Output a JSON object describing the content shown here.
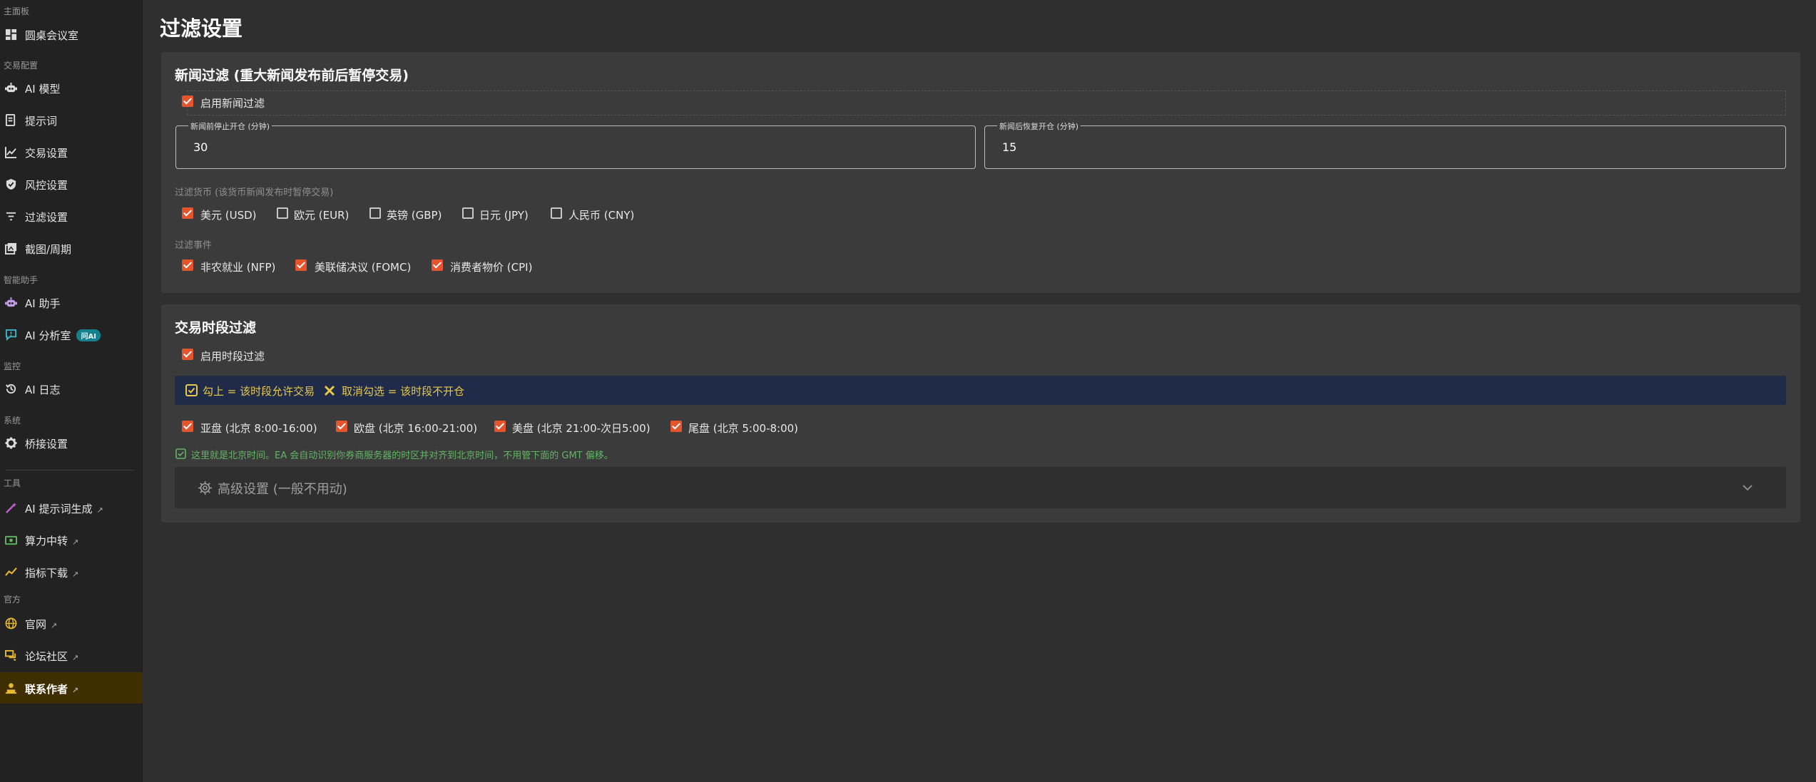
{
  "sidebar": {
    "sections": {
      "dashboard": "主面板",
      "trade_config": "交易配置",
      "assistant": "智能助手",
      "monitor": "监控",
      "system": "系统",
      "tools": "工具",
      "official": "官方"
    },
    "items": {
      "room": "圆桌会议室",
      "ai_model": "AI 模型",
      "prompts": "提示词",
      "trade_settings": "交易设置",
      "risk_settings": "风控设置",
      "filter_settings": "过滤设置",
      "screenshot_period": "截图/周期",
      "ai_assistant": "AI 助手",
      "ai_analysis": "AI 分析室",
      "ai_analysis_badge": "问AI",
      "ai_log": "AI 日志",
      "bridge_settings": "桥接设置",
      "prompt_generator": "AI 提示词生成",
      "compute_relay": "算力中转",
      "indicator_download": "指标下载",
      "website": "官网",
      "forum": "论坛社区",
      "contact_author": "联系作者"
    },
    "external_icon": "↗",
    "active_color": "#3f2f00"
  },
  "page": {
    "title": "过滤设置"
  },
  "news_filter": {
    "title": "新闻过滤 (重大新闻发布前后暂停交易)",
    "enable_label": "启用新闻过滤",
    "enabled": true,
    "stop_before_label": "新闻前停止开仓 (分钟)",
    "stop_before_value": "30",
    "resume_after_label": "新闻后恢复开仓 (分钟)",
    "resume_after_value": "15",
    "currencies_caption": "过滤货币 (该货币新闻发布时暂停交易)",
    "currencies": [
      {
        "label": "美元 (USD)",
        "checked": true
      },
      {
        "label": "欧元 (EUR)",
        "checked": false
      },
      {
        "label": "英镑 (GBP)",
        "checked": false
      },
      {
        "label": "日元 (JPY)",
        "checked": false
      },
      {
        "label": "人民币 (CNY)",
        "checked": false
      }
    ],
    "events_caption": "过滤事件",
    "events": [
      {
        "label": "非农就业 (NFP)",
        "checked": true
      },
      {
        "label": "美联储决议 (FOMC)",
        "checked": true
      },
      {
        "label": "消费者物价 (CPI)",
        "checked": true
      }
    ]
  },
  "session_filter": {
    "title": "交易时段过滤",
    "enable_label": "启用时段过滤",
    "enabled": true,
    "info_checked": "勾上 = 该时段允许交易",
    "info_unchecked": "取消勾选 = 该时段不开仓",
    "sessions": [
      {
        "label": "亚盘 (北京 8:00-16:00)",
        "checked": true
      },
      {
        "label": "欧盘 (北京 16:00-21:00)",
        "checked": true
      },
      {
        "label": "美盘 (北京 21:00-次日5:00)",
        "checked": true
      },
      {
        "label": "尾盘 (北京 5:00-8:00)",
        "checked": true
      }
    ],
    "note": "这里就是北京时间。EA 会自动识别你券商服务器的时区并对齐到北京时间，不用管下面的 GMT 偏移。",
    "advanced_label": "高级设置 (一般不用动)"
  },
  "colors": {
    "accent": "#e5552d",
    "info_bar": "#1f2b48",
    "info_text": "#e8c94a",
    "note_text": "#5fb763",
    "badge": "#15818f"
  }
}
